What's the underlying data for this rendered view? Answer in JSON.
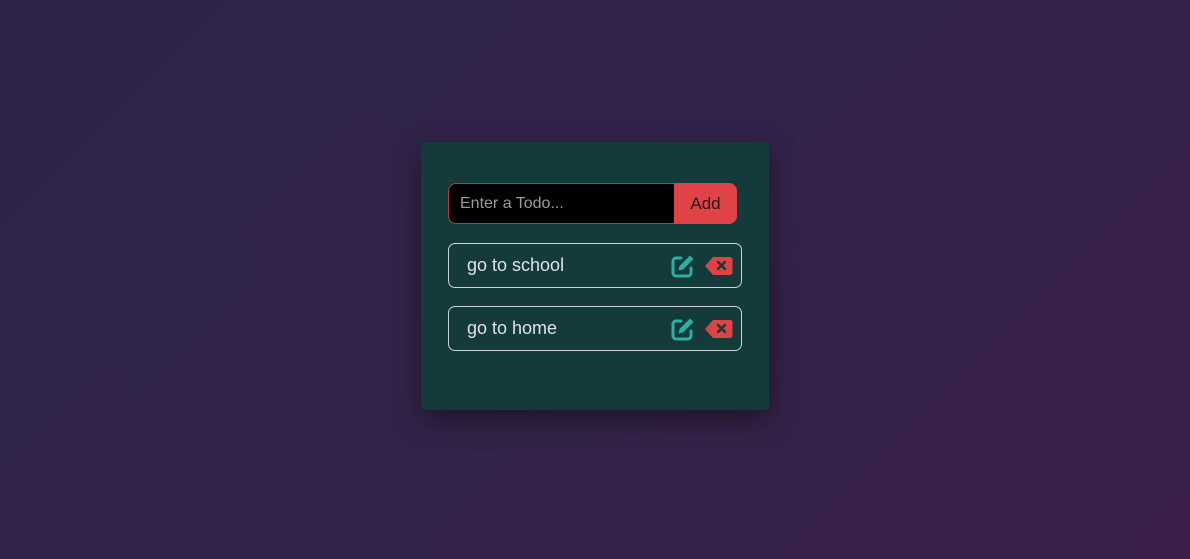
{
  "form": {
    "input_placeholder": "Enter a Todo...",
    "input_value": "",
    "add_label": "Add"
  },
  "todos": [
    {
      "text": "go to school",
      "edit_icon": "edit-icon",
      "delete_icon": "delete-icon"
    },
    {
      "text": "go to home",
      "edit_icon": "edit-icon",
      "delete_icon": "delete-icon"
    }
  ],
  "colors": {
    "background": "#33234a",
    "card": "#143a3c",
    "accent_red": "#e04346",
    "accent_teal": "#2ab0a0",
    "item_border": "#c9d3d3"
  }
}
